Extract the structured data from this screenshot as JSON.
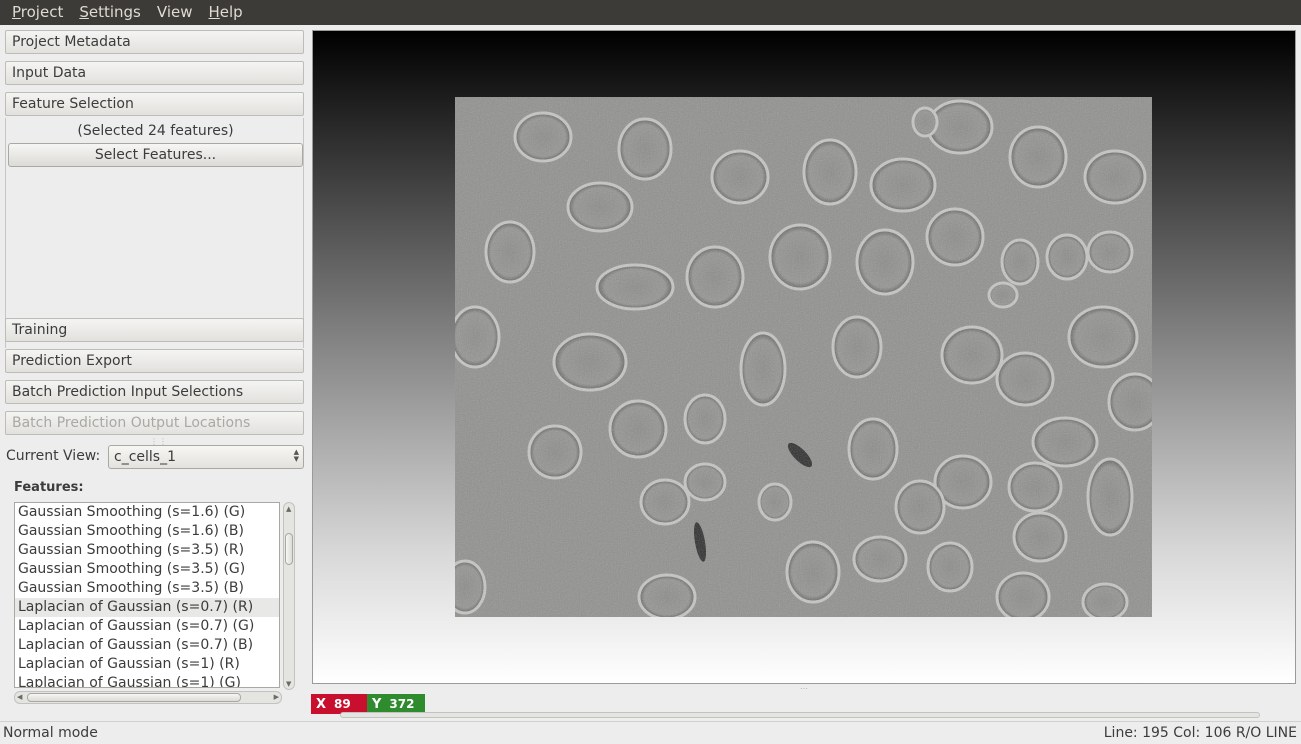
{
  "menubar": {
    "items": [
      {
        "accel": "P",
        "rest": "roject"
      },
      {
        "accel": "S",
        "rest": "ettings"
      },
      {
        "accel": "V",
        "rest": "iew"
      },
      {
        "accel": "H",
        "rest": "elp"
      }
    ]
  },
  "applets": {
    "project_metadata": "Project Metadata",
    "input_data": "Input Data",
    "feature_selection": "Feature Selection",
    "training": "Training",
    "prediction_export": "Prediction Export",
    "batch_input": "Batch Prediction Input Selections",
    "batch_output": "Batch Prediction Output Locations"
  },
  "feature_selection": {
    "selected_text": "(Selected 24 features)",
    "button_label": "Select Features..."
  },
  "current_view": {
    "label": "Current View:",
    "value": "c_cells_1"
  },
  "features": {
    "label": "Features:",
    "items": [
      "Gaussian Smoothing (s=1.6) (G)",
      "Gaussian Smoothing (s=1.6) (B)",
      "Gaussian Smoothing (s=3.5) (R)",
      "Gaussian Smoothing (s=3.5) (G)",
      "Gaussian Smoothing (s=3.5) (B)",
      "Laplacian of Gaussian (s=0.7) (R)",
      "Laplacian of Gaussian (s=0.7) (G)",
      "Laplacian of Gaussian (s=0.7) (B)",
      "Laplacian of Gaussian (s=1) (R)",
      "Laplacian of Gaussian (s=1) (G)"
    ],
    "selected_index": 5
  },
  "coords": {
    "x_label": "X",
    "x_value": "89",
    "y_label": "Y",
    "y_value": "372"
  },
  "status": {
    "left": "Normal mode",
    "right": "Line: 195 Col: 106 R/O LINE"
  },
  "colors": {
    "coord_x_bg": "#c8102e",
    "coord_y_bg": "#2e8b2e",
    "menubar_bg": "#3c3b37"
  }
}
